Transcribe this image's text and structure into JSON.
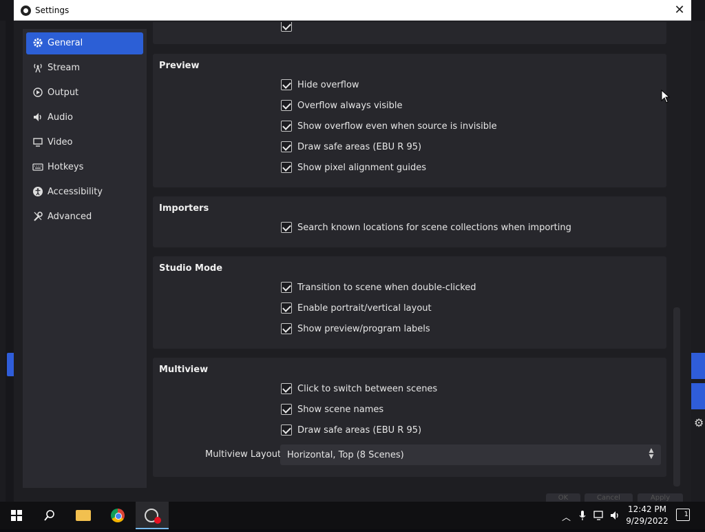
{
  "window": {
    "title": "Settings",
    "close_glyph": "✕"
  },
  "sidebar": {
    "items": [
      {
        "label": "General",
        "icon": "gear-icon",
        "active": true
      },
      {
        "label": "Stream",
        "icon": "antenna-icon",
        "active": false
      },
      {
        "label": "Output",
        "icon": "output-icon",
        "active": false
      },
      {
        "label": "Audio",
        "icon": "speaker-icon",
        "active": false
      },
      {
        "label": "Video",
        "icon": "monitor-icon",
        "active": false
      },
      {
        "label": "Hotkeys",
        "icon": "keyboard-icon",
        "active": false
      },
      {
        "label": "Accessibility",
        "icon": "accessibility-icon",
        "active": false
      },
      {
        "label": "Advanced",
        "icon": "wrench-icon",
        "active": false
      }
    ]
  },
  "groups": {
    "preview": {
      "title": "Preview",
      "options": [
        {
          "label": "Hide overflow",
          "checked": true
        },
        {
          "label": "Overflow always visible",
          "checked": true
        },
        {
          "label": "Show overflow even when source is invisible",
          "checked": true
        },
        {
          "label": "Draw safe areas (EBU R 95)",
          "checked": true
        },
        {
          "label": "Show pixel alignment guides",
          "checked": true
        }
      ]
    },
    "importers": {
      "title": "Importers",
      "options": [
        {
          "label": "Search known locations for scene collections when importing",
          "checked": true
        }
      ]
    },
    "studio_mode": {
      "title": "Studio Mode",
      "options": [
        {
          "label": "Transition to scene when double-clicked",
          "checked": true
        },
        {
          "label": "Enable portrait/vertical layout",
          "checked": true
        },
        {
          "label": "Show preview/program labels",
          "checked": true
        }
      ]
    },
    "multiview": {
      "title": "Multiview",
      "options": [
        {
          "label": "Click to switch between scenes",
          "checked": true
        },
        {
          "label": "Show scene names",
          "checked": true
        },
        {
          "label": "Draw safe areas (EBU R 95)",
          "checked": true
        }
      ],
      "layout_label": "Multiview Layout",
      "layout_value": "Horizontal, Top (8 Scenes)"
    }
  },
  "footer": {
    "ok": "OK",
    "cancel": "Cancel",
    "apply": "Apply"
  },
  "taskbar": {
    "time": "12:42 PM",
    "date": "9/29/2022",
    "notification_count": "1"
  },
  "colors": {
    "accent": "#2c5fd6",
    "panel": "#27272c",
    "background": "#1e1e22"
  }
}
